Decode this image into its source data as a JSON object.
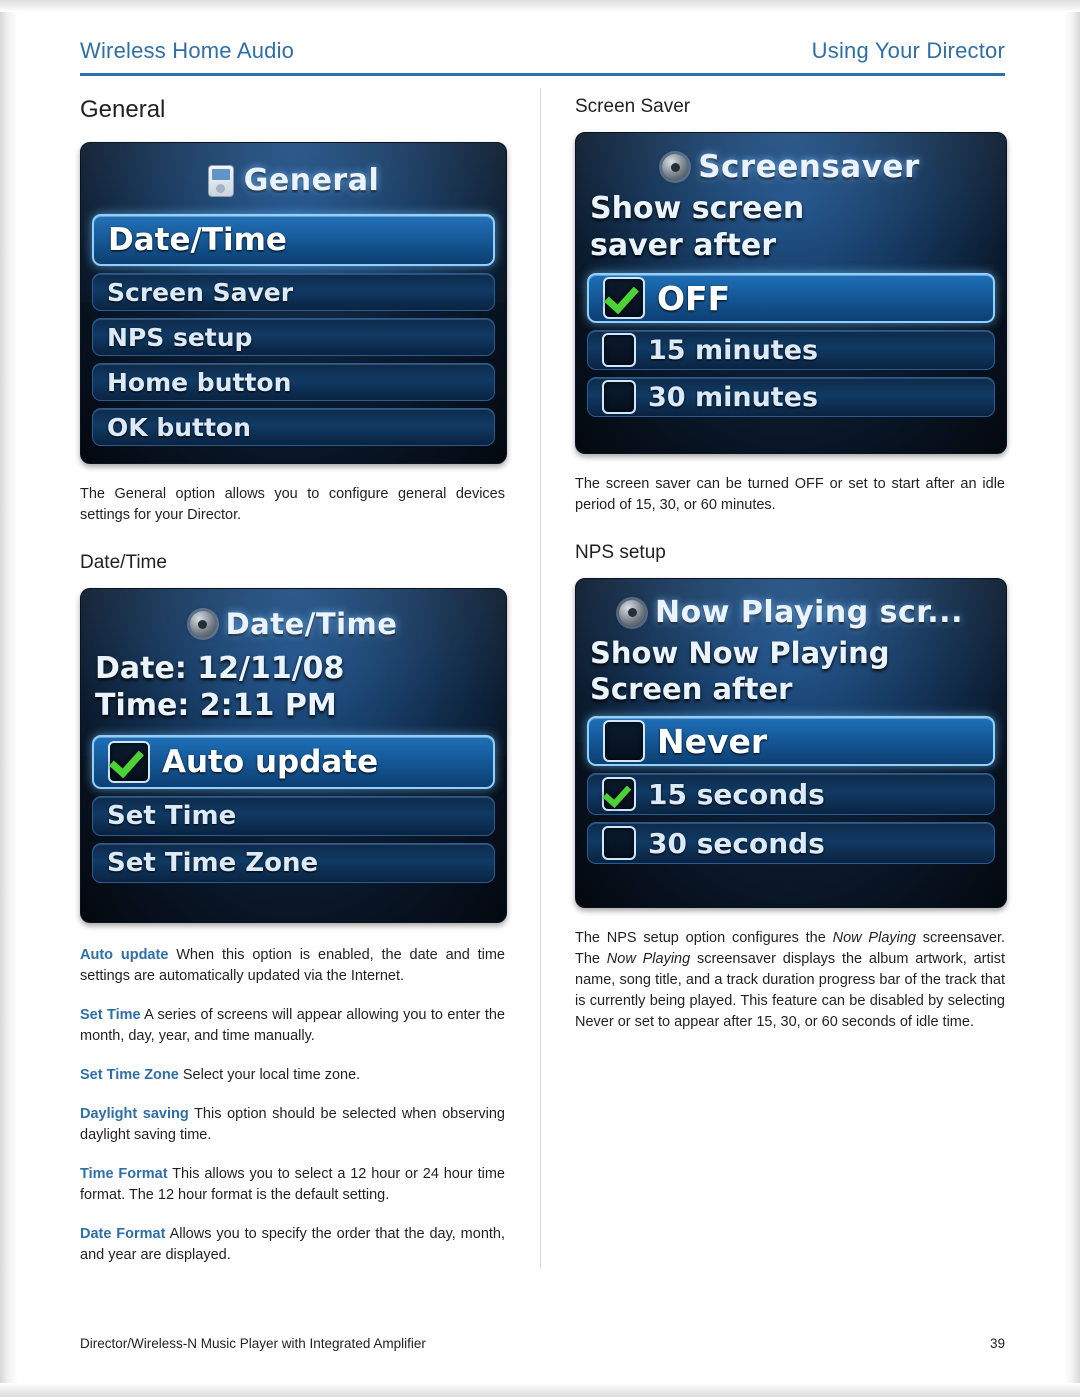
{
  "header": {
    "left_title": "Wireless Home Audio",
    "right_title": "Using Your Director"
  },
  "footer": {
    "text": "Director/Wireless-N Music Player with Integrated Amplifier",
    "page_number": "39"
  },
  "left_column": {
    "section_heading": "General",
    "general_screen": {
      "title": "General",
      "title_icon": "ipod-icon",
      "items": [
        {
          "label": "Date/Time",
          "highlighted": true
        },
        {
          "label": "Screen Saver",
          "highlighted": false
        },
        {
          "label": "NPS setup",
          "highlighted": false
        },
        {
          "label": "Home button",
          "highlighted": false
        },
        {
          "label": "OK button",
          "highlighted": false
        }
      ]
    },
    "general_paragraph": "The General option allows you to configure general devices settings for your Director.",
    "datetime_heading": "Date/Time",
    "datetime_screen": {
      "title": "Date/Time",
      "title_icon": "gear-icon",
      "date_line": "Date: 12/11/08",
      "time_line": "Time: 2:11 PM",
      "items": [
        {
          "label": "Auto update",
          "checked": true,
          "highlighted": true
        },
        {
          "label": "Set Time",
          "checked": false,
          "highlighted": false
        },
        {
          "label": "Set Time Zone",
          "checked": false,
          "highlighted": false
        }
      ]
    },
    "definitions": [
      {
        "term": "Auto update",
        "text": "When this option is enabled, the date and time settings are automatically updated via the Internet."
      },
      {
        "term": "Set Time",
        "text": "A series of screens will appear allowing you to enter the month, day, year, and time manually."
      },
      {
        "term": "Set Time Zone",
        "text": "Select your local time zone."
      },
      {
        "term": "Daylight saving",
        "text": "This option should be selected when observing daylight saving time."
      },
      {
        "term": "Time Format",
        "text": "This allows you to select a 12 hour or 24 hour time format. The 12 hour format is the default setting."
      },
      {
        "term": "Date Format",
        "text": "Allows you to specify the order that the day, month, and year are displayed."
      }
    ]
  },
  "right_column": {
    "screensaver_heading": "Screen Saver",
    "screensaver_screen": {
      "title": "Screensaver",
      "title_icon": "gear-icon",
      "prompt_line_1": "Show screen",
      "prompt_line_2": "saver after",
      "items": [
        {
          "label": "OFF",
          "checked": true,
          "highlighted": true
        },
        {
          "label": "15 minutes",
          "checked": false,
          "highlighted": false
        },
        {
          "label": "30 minutes",
          "checked": false,
          "highlighted": false
        }
      ]
    },
    "screensaver_paragraph": "The screen saver can be turned OFF or set to start after an idle period of 15, 30, or 60 minutes.",
    "nps_heading": "NPS setup",
    "nps_screen": {
      "title": "Now Playing scr...",
      "title_icon": "gear-icon",
      "prompt_line_1": "Show Now Playing",
      "prompt_line_2": "Screen after",
      "items": [
        {
          "label": "Never",
          "checked": false,
          "highlighted": true
        },
        {
          "label": "15 seconds",
          "checked": true,
          "highlighted": false
        },
        {
          "label": "30 seconds",
          "checked": false,
          "highlighted": false
        }
      ]
    },
    "nps_paragraph_parts": {
      "p1": "The NPS setup option configures the ",
      "em1": "Now Playing",
      "p2": " screensaver. The ",
      "em2": "Now Playing",
      "p3": " screensaver displays the album artwork, artist name, song title, and a track duration progress bar of the track that is currently being played. This feature can be disabled by selecting Never or set to appear after 15, 30, or 60 seconds of idle time."
    }
  },
  "colors": {
    "accent": "#2f6fa8",
    "text": "#231f20",
    "screen_dark": "#0b1c30",
    "check_green": "#4cd137"
  }
}
